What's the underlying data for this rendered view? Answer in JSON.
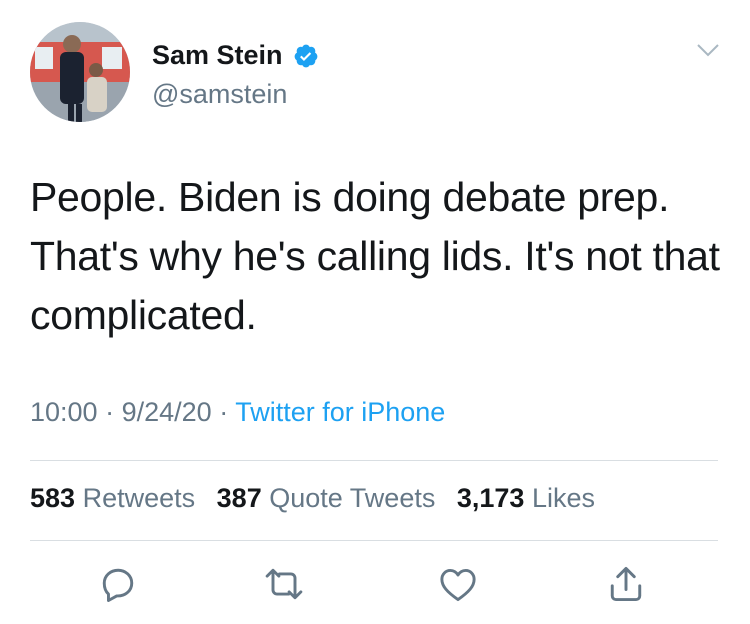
{
  "user": {
    "display_name": "Sam Stein",
    "handle": "@samstein",
    "verified_icon": "verified-badge-icon",
    "avatar_icon": "profile-photo"
  },
  "tweet": {
    "text": "People. Biden is doing debate prep. That's why he's calling lids. It's not that complicated.",
    "time": "10:00",
    "date": "9/24/20",
    "source": "Twitter for iPhone"
  },
  "stats": {
    "retweets_count": "583",
    "retweets_label": "Retweets",
    "quotes_count": "387",
    "quotes_label": "Quote Tweets",
    "likes_count": "3,173",
    "likes_label": "Likes"
  },
  "actions": [
    "reply-icon",
    "retweet-icon",
    "like-icon",
    "share-icon"
  ],
  "colors": {
    "accent": "#1da1f2",
    "secondary_text": "#657786",
    "primary_text": "#14171a",
    "divider": "#d9dee2"
  }
}
